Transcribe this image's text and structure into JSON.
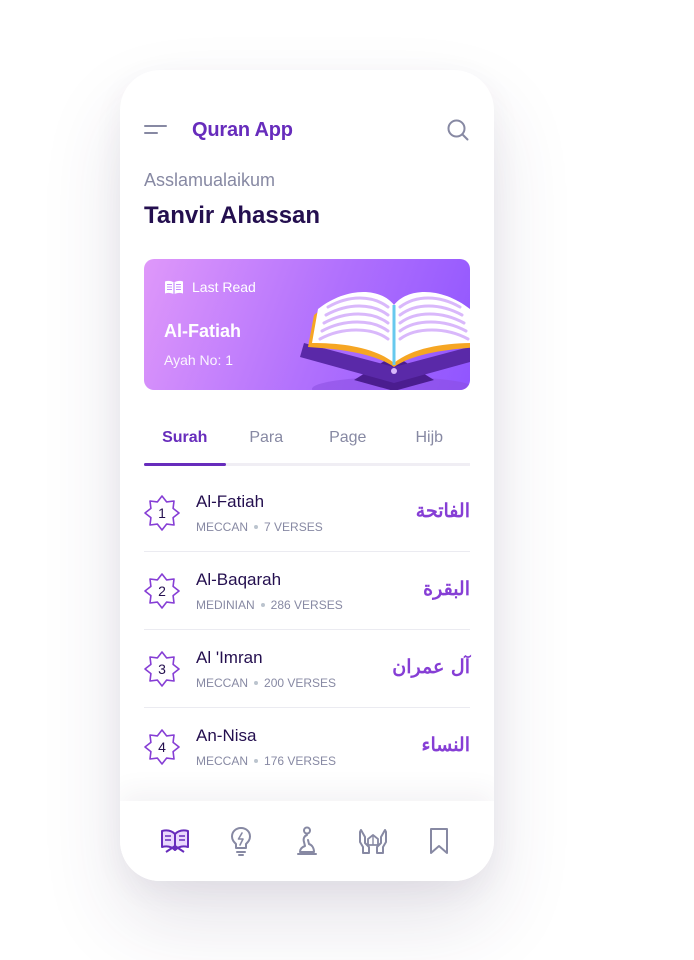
{
  "app": {
    "title": "Quran App"
  },
  "header": {
    "greeting": "Asslamualaikum",
    "user_name": "Tanvir Ahassan"
  },
  "last_read": {
    "label": "Last Read",
    "surah": "Al-Fatiah",
    "ayah": "Ayah No: 1"
  },
  "tabs": [
    {
      "label": "Surah",
      "active": true
    },
    {
      "label": "Para",
      "active": false
    },
    {
      "label": "Page",
      "active": false
    },
    {
      "label": "Hijb",
      "active": false
    }
  ],
  "surahs": [
    {
      "number": "1",
      "name": "Al-Fatiah",
      "type": "MECCAN",
      "verses": "7 VERSES",
      "arabic": "الفاتحة"
    },
    {
      "number": "2",
      "name": "Al-Baqarah",
      "type": "MEDINIAN",
      "verses": "286 VERSES",
      "arabic": "البقرة"
    },
    {
      "number": "3",
      "name": "Al 'Imran",
      "type": "MECCAN",
      "verses": "200 VERSES",
      "arabic": "آل عمران"
    },
    {
      "number": "4",
      "name": "An-Nisa",
      "type": "MECCAN",
      "verses": "176 VERSES",
      "arabic": "النساء"
    }
  ],
  "bottom_nav": [
    {
      "icon": "quran-book-icon",
      "active": true
    },
    {
      "icon": "lamp-icon",
      "active": false
    },
    {
      "icon": "prayer-icon",
      "active": false
    },
    {
      "icon": "dua-hands-icon",
      "active": false
    },
    {
      "icon": "bookmark-icon",
      "active": false
    }
  ],
  "colors": {
    "primary": "#672cbc",
    "text_dark": "#240f4f",
    "text_muted": "#8789a3",
    "arabic": "#863ed5"
  }
}
